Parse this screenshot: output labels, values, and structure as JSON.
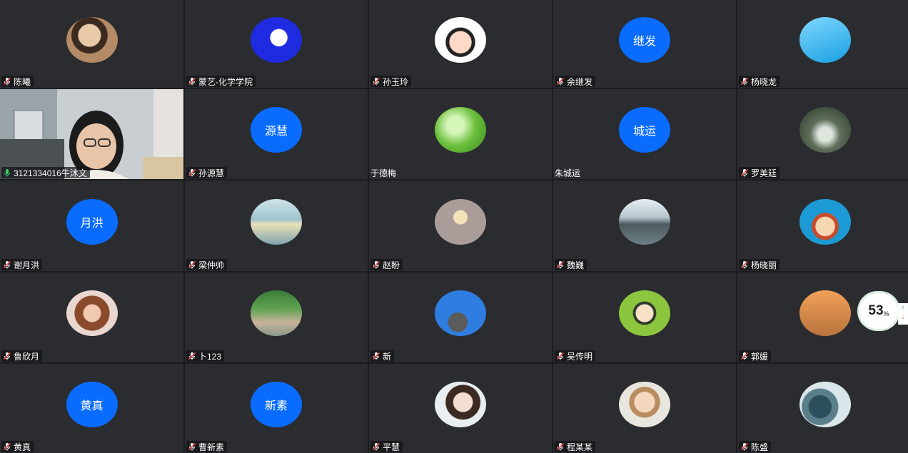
{
  "participants": [
    {
      "name": "陈曦",
      "avatar": "photo",
      "icon": "portrait-photo-icon"
    },
    {
      "name": "蒙艺-化学学院",
      "avatar": "photo",
      "icon": "cartoon-face-icon"
    },
    {
      "name": "孙玉玲",
      "avatar": "photo",
      "icon": "cartoon-girl-icon"
    },
    {
      "name": "余继发",
      "avatar": "text",
      "initials": "继发"
    },
    {
      "name": "杨晓龙",
      "avatar": "photo",
      "icon": "street-lamp-icon"
    },
    {
      "name": "3121334016牛沐文",
      "avatar": "video",
      "speaking": true
    },
    {
      "name": "孙源慧",
      "avatar": "text",
      "initials": "源慧"
    },
    {
      "name": "于德梅",
      "avatar": "photo",
      "icon": "water-drop-leaf-icon",
      "plain": true
    },
    {
      "name": "朱城运",
      "avatar": "text",
      "initials": "城运",
      "plain": true
    },
    {
      "name": "罗美廷",
      "avatar": "photo",
      "icon": "forest-path-icon"
    },
    {
      "name": "谢月洪",
      "avatar": "text",
      "initials": "月洪"
    },
    {
      "name": "梁仲帅",
      "avatar": "photo",
      "icon": "sea-sunrise-icon"
    },
    {
      "name": "赵盼",
      "avatar": "photo",
      "icon": "cartoon-child-icon"
    },
    {
      "name": "魏巍",
      "avatar": "photo",
      "icon": "lake-landscape-icon"
    },
    {
      "name": "杨晓丽",
      "avatar": "photo",
      "icon": "cartoon-pirate-icon"
    },
    {
      "name": "鲁欣月",
      "avatar": "photo",
      "icon": "girl-portrait-icon"
    },
    {
      "name": "卜123",
      "avatar": "photo",
      "icon": "outdoor-portrait-icon"
    },
    {
      "name": "新",
      "avatar": "photo",
      "icon": "cat-sky-icon"
    },
    {
      "name": "吴传明",
      "avatar": "photo",
      "icon": "cartoon-boy-icon"
    },
    {
      "name": "郭媛",
      "avatar": "photo",
      "icon": "sunset-beach-icon"
    },
    {
      "name": "黄真",
      "avatar": "text",
      "initials": "黄真"
    },
    {
      "name": "曹新素",
      "avatar": "text",
      "initials": "新素"
    },
    {
      "name": "平慧",
      "avatar": "photo",
      "icon": "woman-portrait-icon"
    },
    {
      "name": "程某某",
      "avatar": "photo",
      "icon": "woman-eating-icon"
    },
    {
      "name": "陈盛",
      "avatar": "photo",
      "icon": "cartoon-cat-icon"
    }
  ],
  "network_meter": {
    "value": "53",
    "unit": "%",
    "up_arrow": "↑",
    "down_arrow": "↓"
  },
  "colors": {
    "initials_bg": "#0a6cff",
    "tile_bg": "#2b2c30",
    "speaking": "#2fbf5b",
    "muted_mic": "#e04848"
  }
}
